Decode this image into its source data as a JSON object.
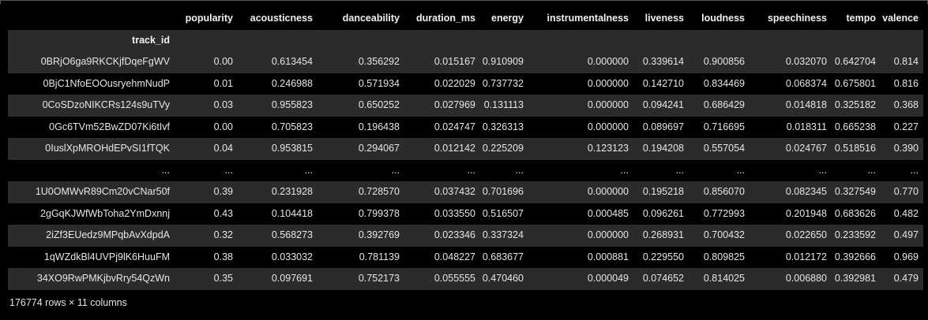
{
  "table": {
    "columns": [
      "popularity",
      "acousticness",
      "danceability",
      "duration_ms",
      "energy",
      "instrumentalness",
      "liveness",
      "loudness",
      "speechiness",
      "tempo",
      "valence"
    ],
    "index_name": "track_id",
    "rows": [
      {
        "index": "0BRjO6ga9RKCKjfDqeFgWV",
        "values": [
          "0.00",
          "0.613454",
          "0.356292",
          "0.015167",
          "0.910909",
          "0.000000",
          "0.339614",
          "0.900856",
          "0.032070",
          "0.642704",
          "0.814"
        ]
      },
      {
        "index": "0BjC1NfoEOOusryehmNudP",
        "values": [
          "0.01",
          "0.246988",
          "0.571934",
          "0.022029",
          "0.737732",
          "0.000000",
          "0.142710",
          "0.834469",
          "0.068374",
          "0.675801",
          "0.816"
        ]
      },
      {
        "index": "0CoSDzoNIKCRs124s9uTVy",
        "values": [
          "0.03",
          "0.955823",
          "0.650252",
          "0.027969",
          "0.131113",
          "0.000000",
          "0.094241",
          "0.686429",
          "0.014818",
          "0.325182",
          "0.368"
        ]
      },
      {
        "index": "0Gc6TVm52BwZD07Ki6tIvf",
        "values": [
          "0.00",
          "0.705823",
          "0.196438",
          "0.024747",
          "0.326313",
          "0.000000",
          "0.089697",
          "0.716695",
          "0.018311",
          "0.665238",
          "0.227"
        ]
      },
      {
        "index": "0IuslXpMROHdEPvSI1fTQK",
        "values": [
          "0.04",
          "0.953815",
          "0.294067",
          "0.012142",
          "0.225209",
          "0.123123",
          "0.194208",
          "0.557054",
          "0.024767",
          "0.518516",
          "0.390"
        ]
      },
      {
        "index": "...",
        "values": [
          "...",
          "...",
          "...",
          "...",
          "...",
          "...",
          "...",
          "...",
          "...",
          "...",
          "..."
        ]
      },
      {
        "index": "1U0OMWvR89Cm20vCNar50f",
        "values": [
          "0.39",
          "0.231928",
          "0.728570",
          "0.037432",
          "0.701696",
          "0.000000",
          "0.195218",
          "0.856070",
          "0.082345",
          "0.327549",
          "0.770"
        ]
      },
      {
        "index": "2gGqKJWfWbToha2YmDxnnj",
        "values": [
          "0.43",
          "0.104418",
          "0.799378",
          "0.033550",
          "0.516507",
          "0.000485",
          "0.096261",
          "0.772993",
          "0.201948",
          "0.683626",
          "0.482"
        ]
      },
      {
        "index": "2iZf3EUedz9MPqbAvXdpdA",
        "values": [
          "0.32",
          "0.568273",
          "0.392769",
          "0.023346",
          "0.337324",
          "0.000000",
          "0.268931",
          "0.700432",
          "0.022650",
          "0.233592",
          "0.497"
        ]
      },
      {
        "index": "1qWZdkBl4UVPj9lK6HuuFM",
        "values": [
          "0.38",
          "0.033032",
          "0.781139",
          "0.048227",
          "0.683677",
          "0.000881",
          "0.229550",
          "0.809825",
          "0.012172",
          "0.392666",
          "0.969"
        ]
      },
      {
        "index": "34XO9RwPMKjbvRry54QzWn",
        "values": [
          "0.35",
          "0.097691",
          "0.752173",
          "0.055555",
          "0.470460",
          "0.000049",
          "0.074652",
          "0.814025",
          "0.006880",
          "0.392981",
          "0.479"
        ]
      }
    ]
  },
  "footer": {
    "shape_text": "176774 rows × 11 columns"
  },
  "colors": {
    "background": "#000000",
    "striped_row": "#2b2b2b",
    "text": "#e6e6e6"
  }
}
